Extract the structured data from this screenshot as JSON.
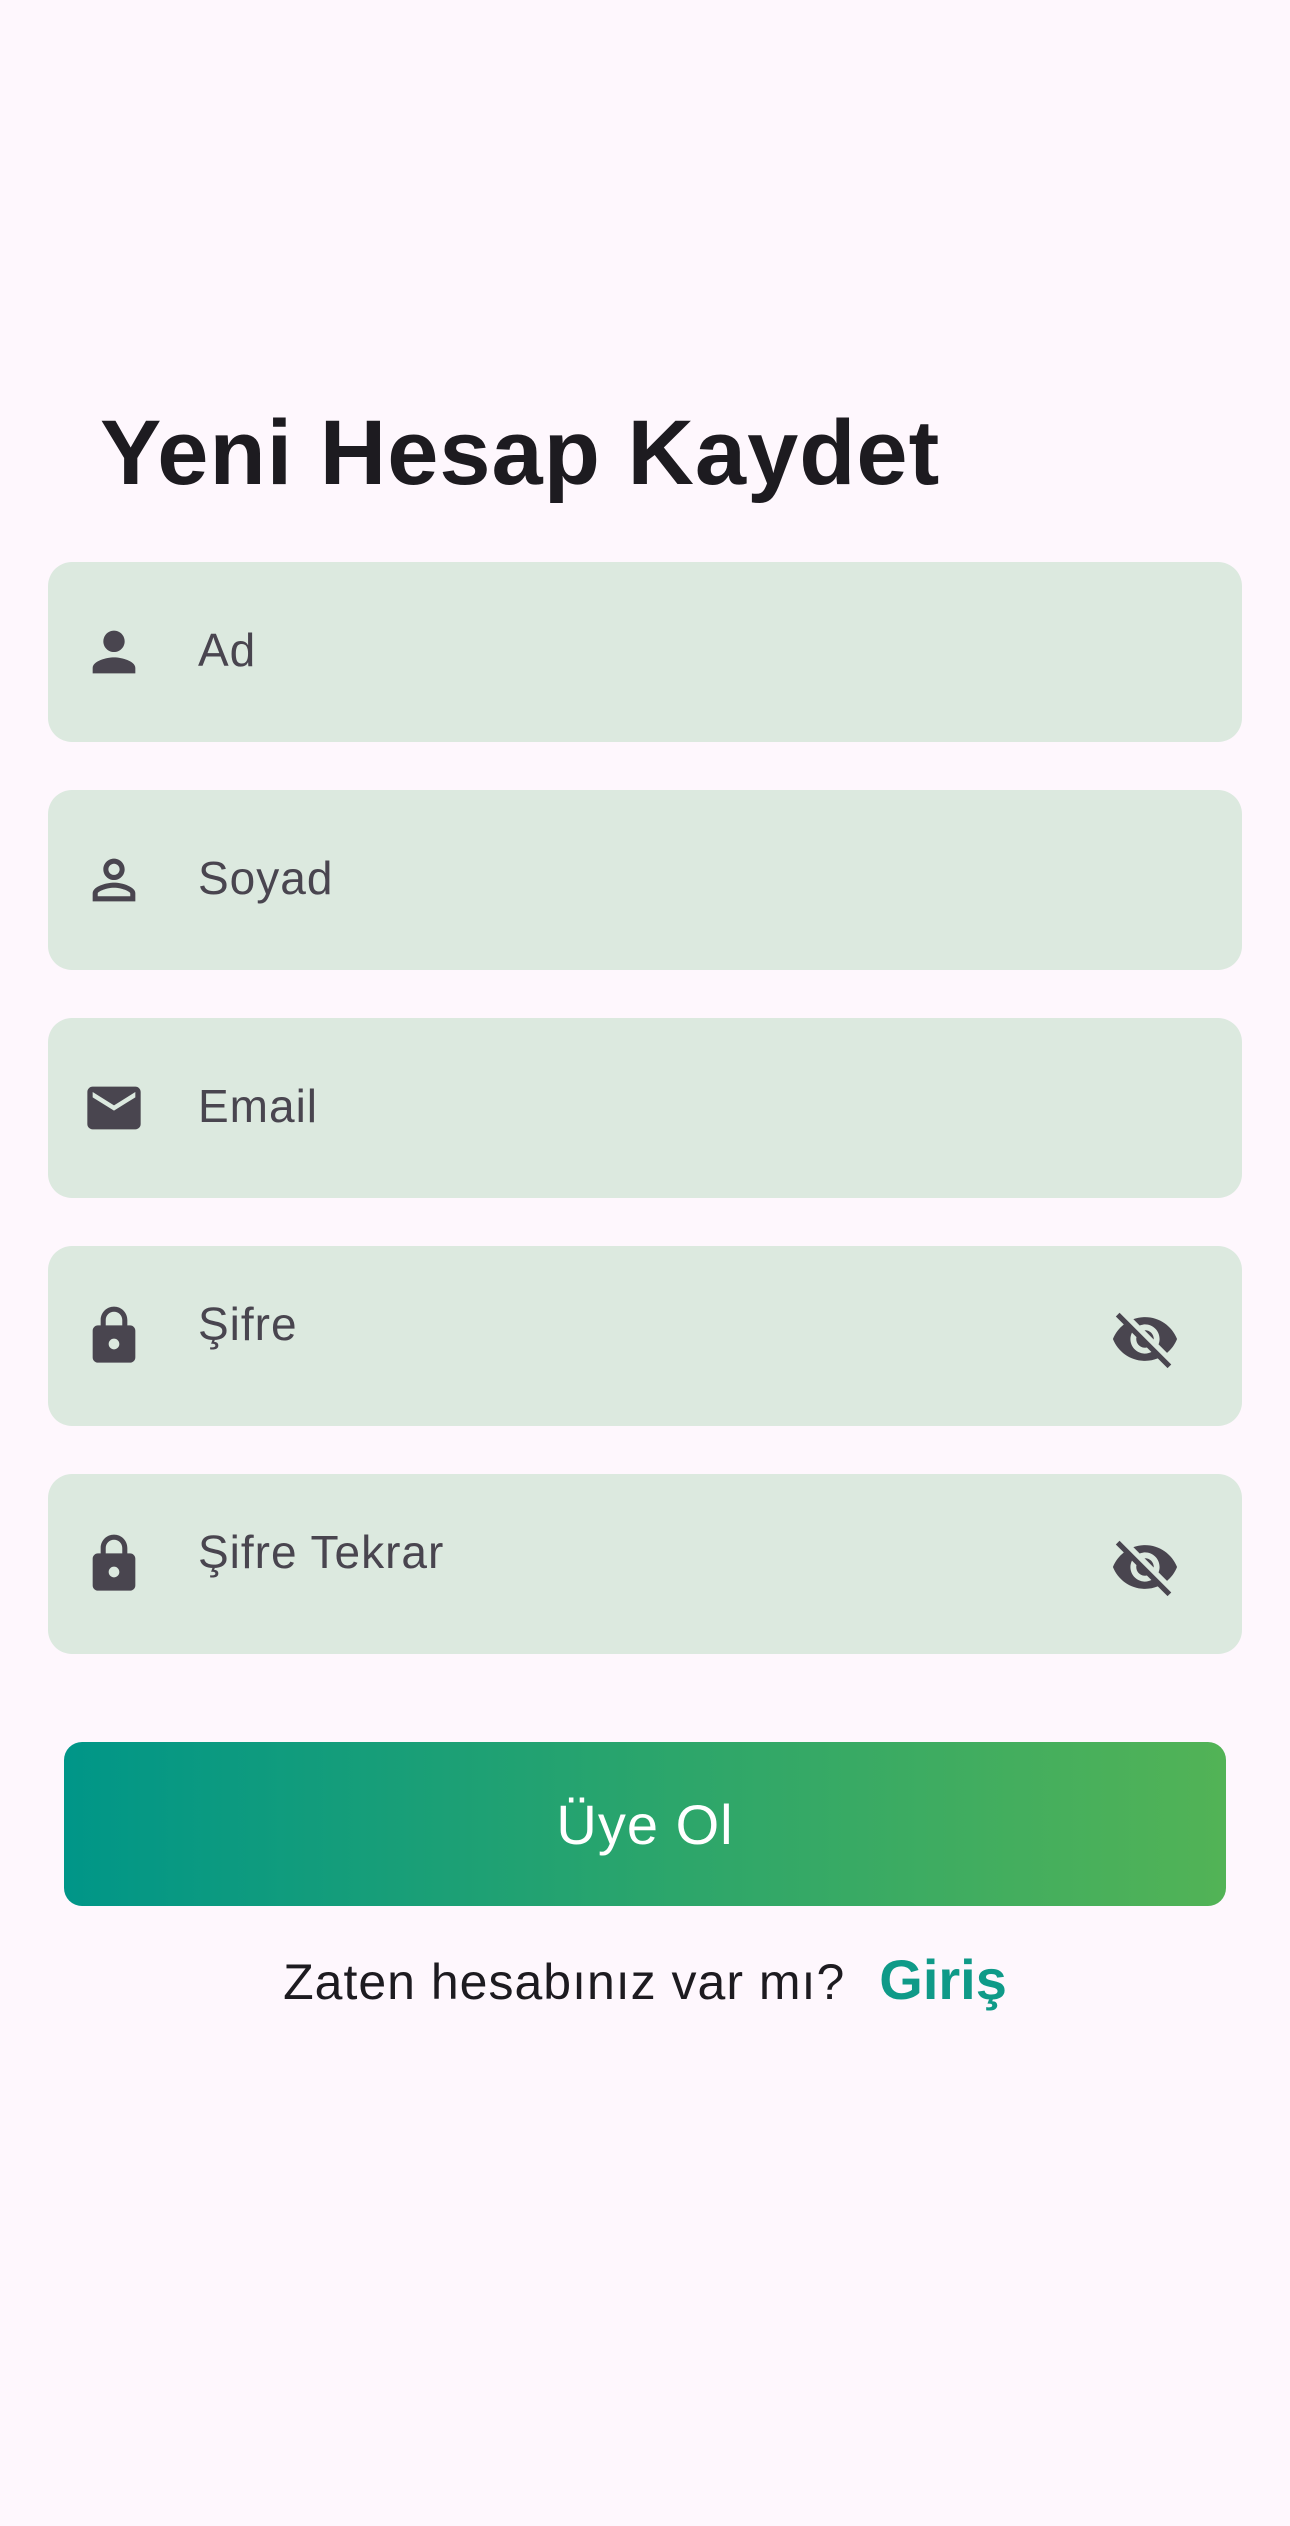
{
  "title": "Yeni Hesap Kaydet",
  "fields": [
    {
      "placeholder": "Ad",
      "icon": "person-icon"
    },
    {
      "placeholder": "Soyad",
      "icon": "person-outline-icon"
    },
    {
      "placeholder": "Email",
      "icon": "mail-icon"
    },
    {
      "placeholder": "Şifre",
      "icon": "lock-icon",
      "trailing_icon": "visibility-off-icon"
    },
    {
      "placeholder": "Şifre Tekrar",
      "icon": "lock-icon",
      "trailing_icon": "visibility-off-icon"
    }
  ],
  "submit_label": "Üye Ol",
  "footer": {
    "question": "Zaten hesabınız var mı?",
    "login_link": "Giriş"
  },
  "colors": {
    "background": "#fef7fd",
    "field_background": "#dce9df",
    "gradient_start": "#009688",
    "gradient_end": "#52b356",
    "link": "#0f9a88"
  }
}
